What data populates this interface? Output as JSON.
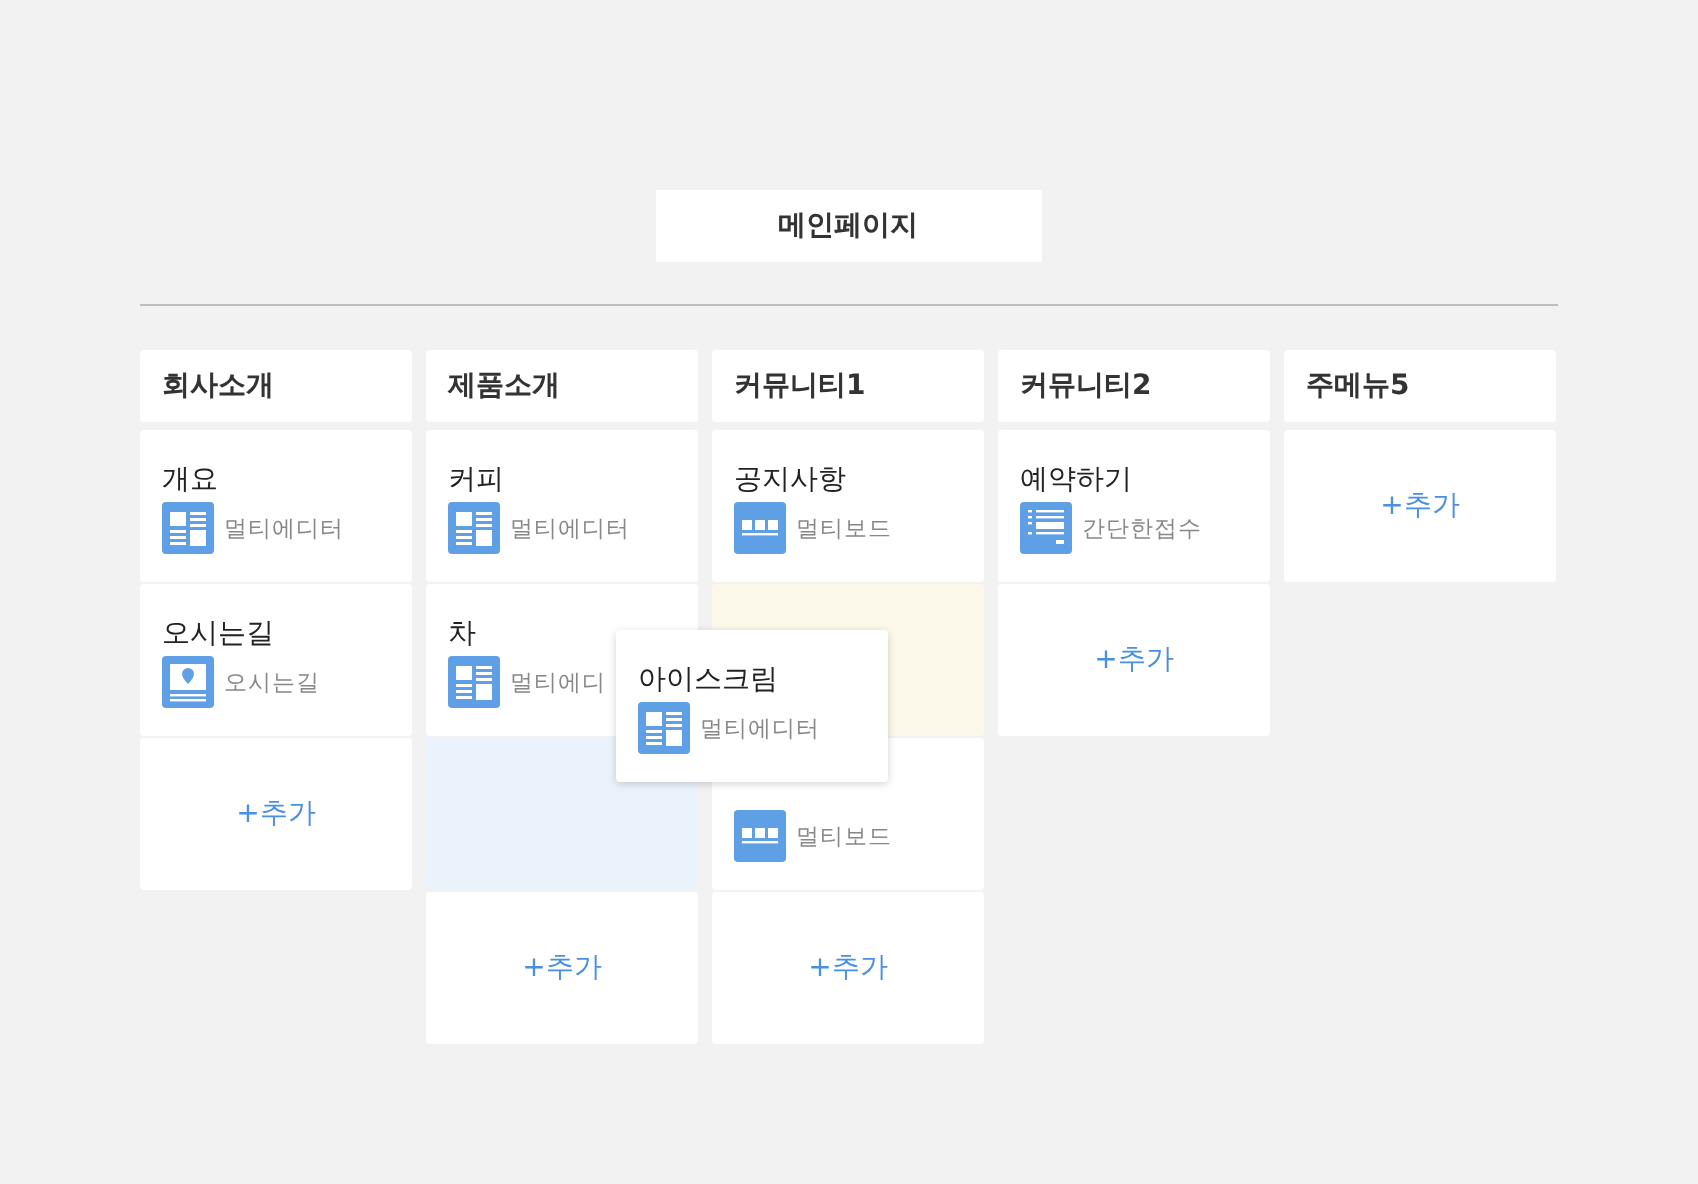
{
  "page_title": "메인페이지",
  "columns": [
    {
      "title": "회사소개",
      "cards": [
        {
          "kind": "editor",
          "name": "개요",
          "type": "멀티에디터"
        },
        {
          "kind": "map",
          "name": "오시는길",
          "type": "오시는길"
        },
        {
          "kind": "add",
          "label": "+추가"
        }
      ]
    },
    {
      "title": "제품소개",
      "cards": [
        {
          "kind": "editor",
          "name": "커피",
          "type": "멀티에디터"
        },
        {
          "kind": "editor",
          "name": "차",
          "type": "멀티에디"
        },
        {
          "kind": "placeholder",
          "color": "#eaf2fc"
        },
        {
          "kind": "add",
          "label": "+추가"
        }
      ]
    },
    {
      "title": "커뮤니티1",
      "cards": [
        {
          "kind": "board",
          "name": "공지사항",
          "type": "멀티보드"
        },
        {
          "kind": "placeholder",
          "color": "#fcf9ea"
        },
        {
          "kind": "board",
          "type": "멀티보드"
        },
        {
          "kind": "add",
          "label": "+추가"
        }
      ]
    },
    {
      "title": "커뮤니티2",
      "cards": [
        {
          "kind": "form",
          "name": "예약하기",
          "type": "간단한접수"
        },
        {
          "kind": "add",
          "label": "+추가"
        }
      ]
    },
    {
      "title": "주메뉴5",
      "cards": [
        {
          "kind": "add",
          "label": "+추가"
        }
      ]
    }
  ],
  "dragged_card": {
    "kind": "editor",
    "name": "아이스크림",
    "type": "멀티에디터"
  }
}
